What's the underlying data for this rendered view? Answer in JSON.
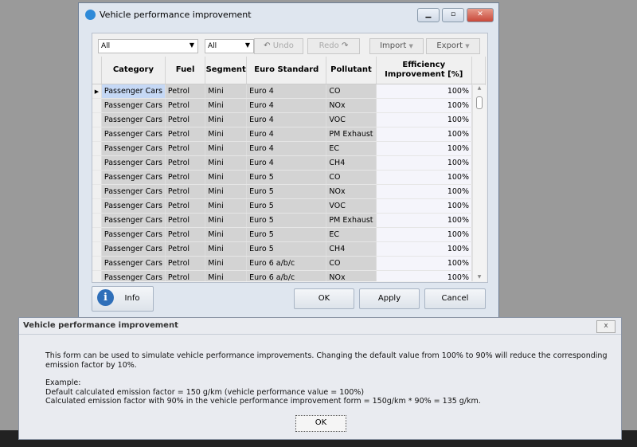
{
  "window": {
    "title": "Vehicle performance improvement"
  },
  "toolbar": {
    "filter1": "All",
    "filter2": "All",
    "undo": "Undo",
    "redo": "Redo",
    "import": "Import",
    "export": "Export"
  },
  "grid": {
    "columns": [
      "Category",
      "Fuel",
      "Segment",
      "Euro Standard",
      "Pollutant",
      "Efficiency Improvement [%]"
    ],
    "rows": [
      [
        "Passenger Cars",
        "Petrol",
        "Mini",
        "Euro 4",
        "CO",
        "100%"
      ],
      [
        "Passenger Cars",
        "Petrol",
        "Mini",
        "Euro 4",
        "NOx",
        "100%"
      ],
      [
        "Passenger Cars",
        "Petrol",
        "Mini",
        "Euro 4",
        "VOC",
        "100%"
      ],
      [
        "Passenger Cars",
        "Petrol",
        "Mini",
        "Euro 4",
        "PM Exhaust",
        "100%"
      ],
      [
        "Passenger Cars",
        "Petrol",
        "Mini",
        "Euro 4",
        "EC",
        "100%"
      ],
      [
        "Passenger Cars",
        "Petrol",
        "Mini",
        "Euro 4",
        "CH4",
        "100%"
      ],
      [
        "Passenger Cars",
        "Petrol",
        "Mini",
        "Euro 5",
        "CO",
        "100%"
      ],
      [
        "Passenger Cars",
        "Petrol",
        "Mini",
        "Euro 5",
        "NOx",
        "100%"
      ],
      [
        "Passenger Cars",
        "Petrol",
        "Mini",
        "Euro 5",
        "VOC",
        "100%"
      ],
      [
        "Passenger Cars",
        "Petrol",
        "Mini",
        "Euro 5",
        "PM Exhaust",
        "100%"
      ],
      [
        "Passenger Cars",
        "Petrol",
        "Mini",
        "Euro 5",
        "EC",
        "100%"
      ],
      [
        "Passenger Cars",
        "Petrol",
        "Mini",
        "Euro 5",
        "CH4",
        "100%"
      ],
      [
        "Passenger Cars",
        "Petrol",
        "Mini",
        "Euro 6 a/b/c",
        "CO",
        "100%"
      ],
      [
        "Passenger Cars",
        "Petrol",
        "Mini",
        "Euro 6 a/b/c",
        "NOx",
        "100%"
      ]
    ]
  },
  "buttons": {
    "info": "Info",
    "ok": "OK",
    "apply": "Apply",
    "cancel": "Cancel"
  },
  "dialog": {
    "title": "Vehicle performance improvement",
    "close": "x",
    "line1": "This form can be used to simulate vehicle performance improvements. Changing the default value from 100% to 90% will reduce the corresponding emission factor by 10%.",
    "line2": "Example:",
    "line3": "Default calculated emission factor = 150 g/km (vehicle performance value = 100%)",
    "line4": "Calculated emission factor with 90% in the vehicle performance improvement form = 150g/km * 90% = 135 g/km.",
    "ok": "OK"
  }
}
